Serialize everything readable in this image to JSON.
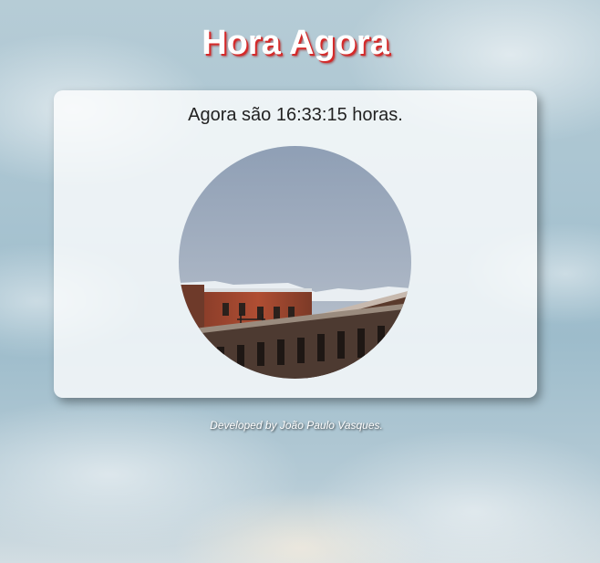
{
  "header": {
    "title": "Hora Agora"
  },
  "card": {
    "message": "Agora são 16:33:15 horas."
  },
  "footer": {
    "credit": "Developed by João Paulo Vasques."
  },
  "colors": {
    "title_shadow": "#d42a2a",
    "brick": "#a6472e"
  },
  "icons": {
    "photo": "building-photo"
  }
}
